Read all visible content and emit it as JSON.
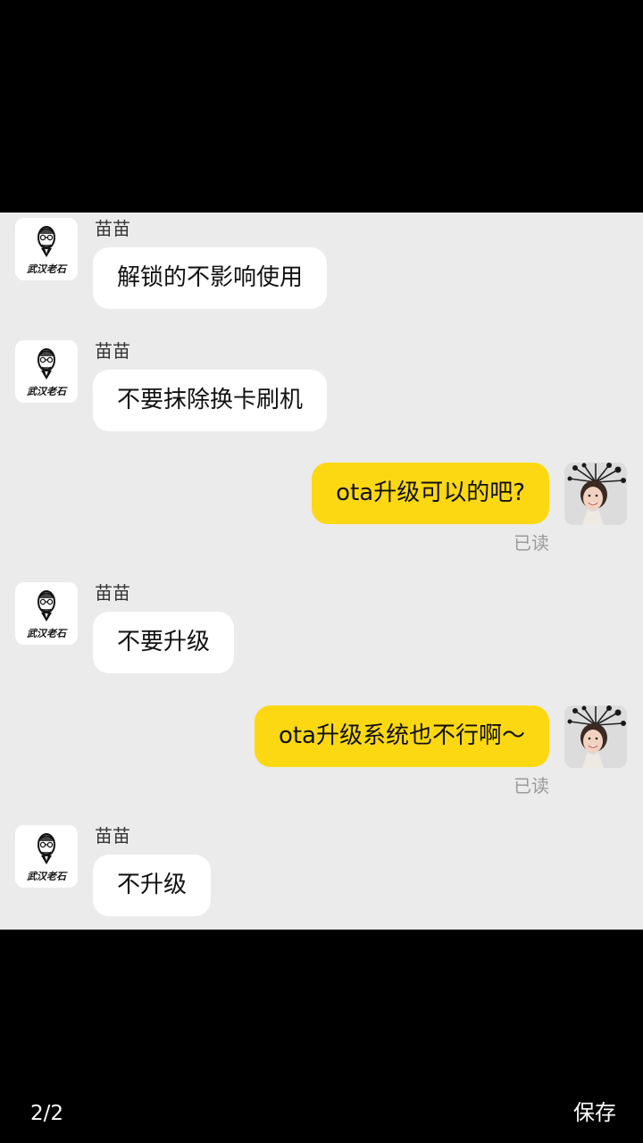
{
  "viewer": {
    "page_indicator": "2/2",
    "save_label": "保存"
  },
  "colors": {
    "background": "#000000",
    "chat_background": "#ebebeb",
    "incoming_bubble": "#ffffff",
    "outgoing_bubble": "#fcd813",
    "read_receipt": "#9a9a9a"
  },
  "avatar_logo_text": "武汉老石",
  "messages": [
    {
      "direction": "in",
      "sender": "苗苗",
      "text": "解锁的不影响使用"
    },
    {
      "direction": "in",
      "sender": "苗苗",
      "text": "不要抹除换卡刷机"
    },
    {
      "direction": "out",
      "text": "ota升级可以的吧?",
      "receipt": "已读"
    },
    {
      "direction": "in",
      "sender": "苗苗",
      "text": "不要升级"
    },
    {
      "direction": "out",
      "text": "ota升级系统也不行啊～",
      "receipt": "已读"
    },
    {
      "direction": "in",
      "sender": "苗苗",
      "text": "不升级"
    }
  ]
}
